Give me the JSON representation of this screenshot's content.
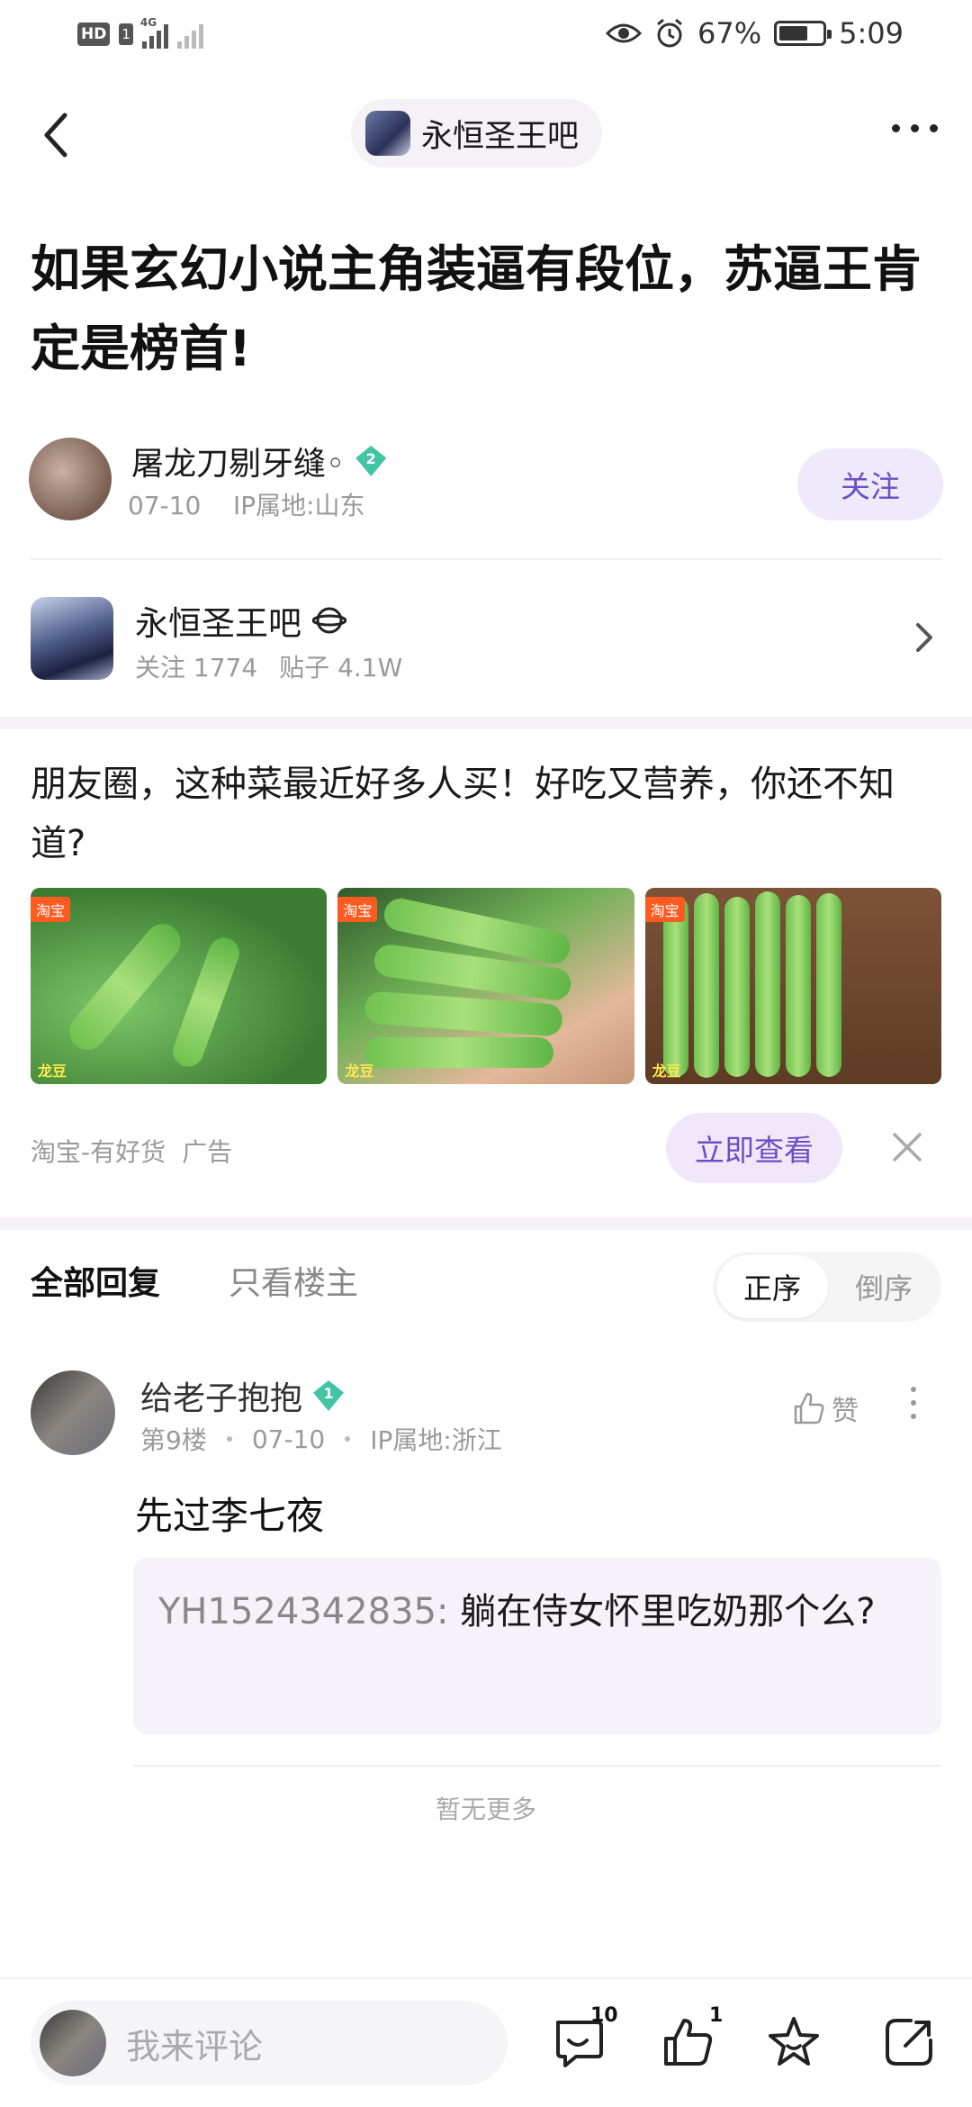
{
  "status_bar": {
    "hd": "HD",
    "sim": "1",
    "network": "4G",
    "battery": "67%",
    "battery_level": 0.67,
    "time": "5:09"
  },
  "nav": {
    "forum_name": "永恒圣王吧"
  },
  "post": {
    "title": "如果玄幻小说主角装逼有段位，苏逼王肯定是榜首!",
    "author": {
      "name": "屠龙刀剔牙缝◦",
      "level": "2",
      "meta": "07-10    IP属地:山东"
    },
    "follow_label": "关注"
  },
  "forum_card": {
    "name": "永恒圣王吧",
    "followers": "关注 1774",
    "posts": "贴子 4.1W"
  },
  "ad": {
    "text": "朋友圈，这种菜最近好多人买！好吃又营养，你还不知道?",
    "images": [
      {
        "tag": "淘宝",
        "caption": "龙豆"
      },
      {
        "tag": "淘宝",
        "caption": "龙豆"
      },
      {
        "tag": "淘宝",
        "caption": "龙豆"
      }
    ],
    "source": "淘宝-有好货",
    "ad_label": "广告",
    "cta": "立即查看"
  },
  "replies": {
    "tab_all": "全部回复",
    "tab_op": "只看楼主",
    "sort_asc": "正序",
    "sort_desc": "倒序",
    "comment": {
      "name": "给老子抱抱",
      "level": "1",
      "floor": "第9楼",
      "date": "07-10",
      "ip": "IP属地:浙江",
      "like_label": "赞",
      "text": "先过李七夜",
      "sub_user": "YH1524342835:",
      "sub_text": " 躺在侍女怀里吃奶那个么?"
    },
    "no_more": "暂无更多"
  },
  "bottom_bar": {
    "placeholder": "我来评论",
    "comment_count": "10",
    "like_count": "1"
  }
}
